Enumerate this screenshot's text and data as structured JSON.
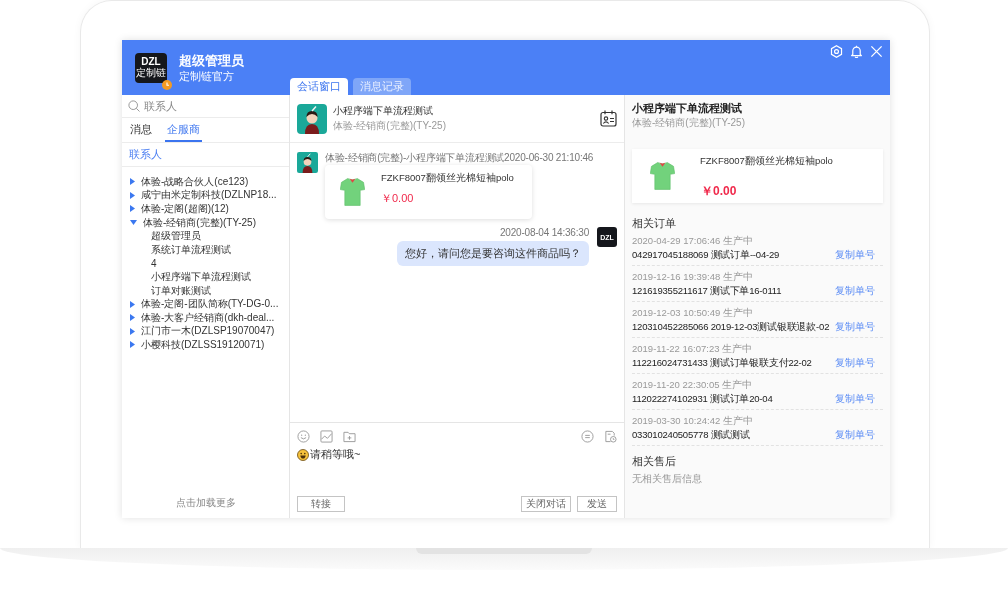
{
  "header": {
    "logo": {
      "title": "DZL",
      "subtitle": "定制链"
    },
    "user_name": "超级管理员",
    "organization": "定制链官方"
  },
  "conversation_tabs": [
    {
      "label": "会话窗口",
      "selected": true
    },
    {
      "label": "消息记录",
      "selected": false
    }
  ],
  "sidebar": {
    "search": {
      "placeholder": "联系人"
    },
    "tabs": [
      {
        "label": "消息",
        "selected": false
      },
      {
        "label": "企服商",
        "selected": true
      }
    ],
    "section_title": "联系人",
    "tree": [
      {
        "label": "体验-战略合伙人(ce123)",
        "expanded": false
      },
      {
        "label": "咸宁由米定制科技(DZLNP18...",
        "expanded": false
      },
      {
        "label": "体验-定阁(超阁)(12)",
        "expanded": false
      },
      {
        "label": "体验-经销商(完整)(TY-25)",
        "expanded": true,
        "children": [
          {
            "label": "超级管理员"
          },
          {
            "label": "系统订单流程测试"
          },
          {
            "label": "4"
          },
          {
            "label": "小程序端下单流程测试"
          },
          {
            "label": "订单对账测试"
          }
        ]
      },
      {
        "label": "体验-定阁-团队简称(TY-DG-0...",
        "expanded": false
      },
      {
        "label": "体验-大客户经销商(dkh-deal...",
        "expanded": false
      },
      {
        "label": "江门市一木(DZLSP19070047)",
        "expanded": false
      },
      {
        "label": "小樱科技(DZLSS19120071)",
        "expanded": false
      }
    ],
    "load_more": "点击加载更多"
  },
  "chat": {
    "header": {
      "title": "小程序端下单流程测试",
      "subtitle": "体验-经销商(完整)(TY-25)"
    },
    "messages": [
      {
        "kind": "product",
        "outgoing": false,
        "meta": "体验-经销商(完整)-小程序端下单流程测试2020-06-30 21:10:46",
        "product": {
          "name": "FZKF8007翻领丝光棉短袖polo",
          "price": "￥0.00"
        }
      },
      {
        "kind": "text",
        "outgoing": true,
        "meta": "2020-08-04 14:36:30",
        "avatar_text": "DZL",
        "text": "您好，请问您是要咨询这件商品吗？"
      }
    ],
    "composer": {
      "value": "请稍等哦~"
    },
    "buttons_left": [
      "转接"
    ],
    "buttons_right": [
      "关闭对话",
      "发送"
    ]
  },
  "detail": {
    "title": "小程序端下单流程测试",
    "subtitle": "体验-经销商(完整)(TY-25)",
    "product": {
      "name": "FZKF8007翻领丝光棉短袖polo",
      "price": "￥0.00"
    },
    "orders_title": "相关订单",
    "orders": [
      {
        "meta": "2020-04-29 17:06:46 生产中",
        "title": "042917045188069 测试订单--04-29",
        "action": "复制单号"
      },
      {
        "meta": "2019-12-16 19:39:48 生产中",
        "title": "121619355211617 测试下单16-0111",
        "action": "复制单号"
      },
      {
        "meta": "2019-12-03 10:50:49 生产中",
        "title": "120310452285066 2019-12-03测试银联退款-02",
        "action": "复制单号"
      },
      {
        "meta": "2019-11-22 16:07:23 生产中",
        "title": "112216024731433 测试订单银联支付22-02",
        "action": "复制单号"
      },
      {
        "meta": "2019-11-20 22:30:05 生产中",
        "title": "112022274102931 测试订单20-04",
        "action": "复制单号"
      },
      {
        "meta": "2019-03-30 10:24:42 生产中",
        "title": "033010240505778 测试测试",
        "action": "复制单号"
      }
    ],
    "after_sales_title": "相关售后",
    "after_sales_empty": "无相关售后信息"
  }
}
